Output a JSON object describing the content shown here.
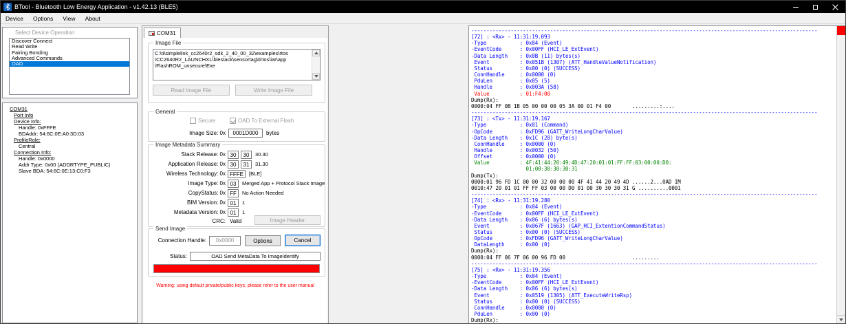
{
  "window": {
    "title": "BTool - Bluetooth Low Energy Application - v1.42.13 (BLE5)"
  },
  "menu": {
    "items": [
      "Device",
      "Options",
      "View",
      "About"
    ]
  },
  "colors": {
    "accent": "#0078d7",
    "progress_red": "#ff0000",
    "warning_red": "#ff0000",
    "log_blue": "#0000ff",
    "log_red": "#ff0000",
    "log_green": "#008000"
  },
  "device_operation": {
    "label": "Select Device Operation",
    "items": [
      {
        "label": "Discover Connect",
        "selected": false
      },
      {
        "label": "Read Write",
        "selected": false
      },
      {
        "label": "Pairing Bonding",
        "selected": false
      },
      {
        "label": "Advanced Commands",
        "selected": false
      },
      {
        "label": "OAD",
        "selected": true
      }
    ]
  },
  "device_tree": {
    "nodes": [
      {
        "label": "COM31",
        "indent": 0,
        "section": true
      },
      {
        "label": "Port Info",
        "indent": 1,
        "section": true
      },
      {
        "label": "Device Info:",
        "indent": 1,
        "section": true
      },
      {
        "label": "Handle: 0xFFFE",
        "indent": 2,
        "section": false
      },
      {
        "label": "BDAddr: 54:6C:0E:A0:3D:03",
        "indent": 2,
        "section": false
      },
      {
        "label": "ProfileRole:",
        "indent": 1,
        "section": true
      },
      {
        "label": "Central",
        "indent": 2,
        "section": false
      },
      {
        "label": "Connection Info:",
        "indent": 1,
        "section": true
      },
      {
        "label": "Handle: 0x0000",
        "indent": 2,
        "section": false
      },
      {
        "label": "Addr Type: 0x00 (ADDRTYPE_PUBLIC)",
        "indent": 2,
        "section": false
      },
      {
        "label": "Slave BDA: 54:6C:0E:13:C0:F3",
        "indent": 2,
        "section": false
      }
    ]
  },
  "oad_panel": {
    "tab_label": "COM31",
    "image_file": {
      "group_label": "Image File",
      "path_lines": [
        "C:\\ti\\simplelink_cc2640r2_sdk_2_40_00_32\\examples\\rtos",
        "\\CC2640R2_LAUNCHXL\\blestack\\sensortag\\tirtos\\iar\\app",
        "\\FlashROM_unsecure\\Exe"
      ],
      "read_button": "Read Image File",
      "write_button": "Write Image File"
    },
    "general": {
      "group_label": "General",
      "secure_label": "Secure",
      "secure_checked": false,
      "oad_external_label": "OAD To External Flash",
      "oad_external_checked": true,
      "image_size_label": "Image Size: 0x",
      "image_size_value": "0001D000",
      "image_size_unit": "bytes"
    },
    "metadata": {
      "group_label": "Image Metadata Summary",
      "rows": [
        {
          "label": "Stack Release: 0x",
          "boxes": [
            "30",
            "30"
          ],
          "suffix": "30.30"
        },
        {
          "label": "Application Release: 0x",
          "boxes": [
            "30",
            "31"
          ],
          "suffix": "31.30"
        },
        {
          "label": "Wireless Technology: 0x",
          "boxes": [
            "FFFE"
          ],
          "suffix": "[BLE]"
        },
        {
          "label": "Image Type: 0x",
          "boxes": [
            "03"
          ],
          "suffix": "Merged App + Protocol Stack Image"
        },
        {
          "label": "CopyStatus: 0x",
          "boxes": [
            "FF"
          ],
          "suffix": "No Action Needed"
        },
        {
          "label": "BIM Version: 0x",
          "boxes": [
            "01"
          ],
          "suffix": "1"
        },
        {
          "label": "Metadata Version: 0x",
          "boxes": [
            "01"
          ],
          "suffix": "1"
        }
      ],
      "crc_label": "CRC:",
      "crc_value": "Valid",
      "image_header_button": "Image Header"
    },
    "send_image": {
      "group_label": "Send Image",
      "connection_handle_label": "Connection Handle:",
      "connection_handle_value": "0x0000",
      "options_button": "Options",
      "cancel_button": "Cancel",
      "status_label": "Status:",
      "status_value": "OAD Send MetaData To ImageIdentify",
      "progress_percent": 100
    },
    "warning": "Warning: using default private/public keys, please refer to the user manual"
  },
  "log": {
    "lines": [
      {
        "t": "------------------------------------------------------------------------------------------------------------------",
        "c": "b"
      },
      {
        "t": "[72] : <Rx> - 11:31:19.093",
        "c": "b"
      },
      {
        "t": "-Type           : 0x04 (Event)",
        "c": "b"
      },
      {
        "t": "-EventCode      : 0x00FF (HCI_LE_ExtEvent)",
        "c": "b"
      },
      {
        "t": "-Data Length    : 0x0B (11) bytes(s)",
        "c": "b"
      },
      {
        "t": " Event          : 0x051B (1307) (ATT_HandleValueNotification)",
        "c": "b"
      },
      {
        "t": " Status         : 0x00 (0) (SUCCESS)",
        "c": "b"
      },
      {
        "t": " ConnHandle     : 0x0000 (0)",
        "c": "b"
      },
      {
        "t": " PduLen         : 0x05 (5)",
        "c": "b"
      },
      {
        "t": " Handle         : 0x003A (58)",
        "c": "b"
      },
      {
        "t": " Value          : 01:F4:00",
        "c": "r"
      },
      {
        "t": "Dump(Rx):",
        "c": "k"
      },
      {
        "t": "0000:04 FF 0B 1B 05 00 00 00 05 3A 00 01 F4 00       .........:....",
        "c": "k"
      },
      {
        "t": "------------------------------------------------------------------------------------------------------------------",
        "c": "b"
      },
      {
        "t": "[73] : <Tx> - 11:31:19.167",
        "c": "b"
      },
      {
        "t": "-Type           : 0x01 (Command)",
        "c": "b"
      },
      {
        "t": "-OpCode         : 0xFD96 (GATT_WriteLongCharValue)",
        "c": "b"
      },
      {
        "t": "-Data Length    : 0x1C (28) byte(s)",
        "c": "b"
      },
      {
        "t": " ConnHandle     : 0x0000 (0)",
        "c": "b"
      },
      {
        "t": " Handle         : 0x0032 (50)",
        "c": "b"
      },
      {
        "t": " Offset         : 0x0000 (0)",
        "c": "b"
      },
      {
        "t": " Value          : 4F:41:44:20:49:4D:47:20:01:01:FF:FF:03:00:00:D0:",
        "c": "g"
      },
      {
        "t": "                  01:00:30:30:30:31",
        "c": "g"
      },
      {
        "t": "Dump(Tx):",
        "c": "k"
      },
      {
        "t": "0000:01 96 FD 1C 00 00 32 00 00 00 4F 41 44 20 49 4D ......2...OAD IM",
        "c": "k"
      },
      {
        "t": "0010:47 20 01 01 FF FF 03 00 00 D0 01 00 30 30 30 31 G ..........0001",
        "c": "k"
      },
      {
        "t": "------------------------------------------------------------------------------------------------------------------",
        "c": "b"
      },
      {
        "t": "[74] : <Rx> - 11:31:19.280",
        "c": "b"
      },
      {
        "t": "-Type           : 0x04 (Event)",
        "c": "b"
      },
      {
        "t": "-EventCode      : 0x00FF (HCI_LE_ExtEvent)",
        "c": "b"
      },
      {
        "t": "-Data Length    : 0x06 (6) bytes(s)",
        "c": "b"
      },
      {
        "t": " Event          : 0x067F (1663) (GAP_HCI_ExtentionCommandStatus)",
        "c": "b"
      },
      {
        "t": " Status         : 0x00 (0) (SUCCESS)",
        "c": "b"
      },
      {
        "t": " OpCode         : 0xFD96 (GATT_WriteLongCharValue)",
        "c": "b"
      },
      {
        "t": " DataLength     : 0x00 (0)",
        "c": "b"
      },
      {
        "t": "Dump(Rx):",
        "c": "k"
      },
      {
        "t": "0000:04 FF 06 7F 06 00 96 FD 00                      .........",
        "c": "k"
      },
      {
        "t": "------------------------------------------------------------------------------------------------------------------",
        "c": "b"
      },
      {
        "t": "[75] : <Rx> - 11:31:19.356",
        "c": "b"
      },
      {
        "t": "-Type           : 0x04 (Event)",
        "c": "b"
      },
      {
        "t": "-EventCode      : 0x00FF (HCI_LE_ExtEvent)",
        "c": "b"
      },
      {
        "t": "-Data Length    : 0x06 (6) bytes(s)",
        "c": "b"
      },
      {
        "t": " Event          : 0x0519 (1305) (ATT_ExecuteWriteRsp)",
        "c": "b"
      },
      {
        "t": " Status         : 0x00 (0) (SUCCESS)",
        "c": "b"
      },
      {
        "t": " ConnHandle     : 0x0000 (0)",
        "c": "b"
      },
      {
        "t": " PduLen         : 0x00 (0)",
        "c": "b"
      },
      {
        "t": "Dump(Rx):",
        "c": "k"
      }
    ]
  }
}
